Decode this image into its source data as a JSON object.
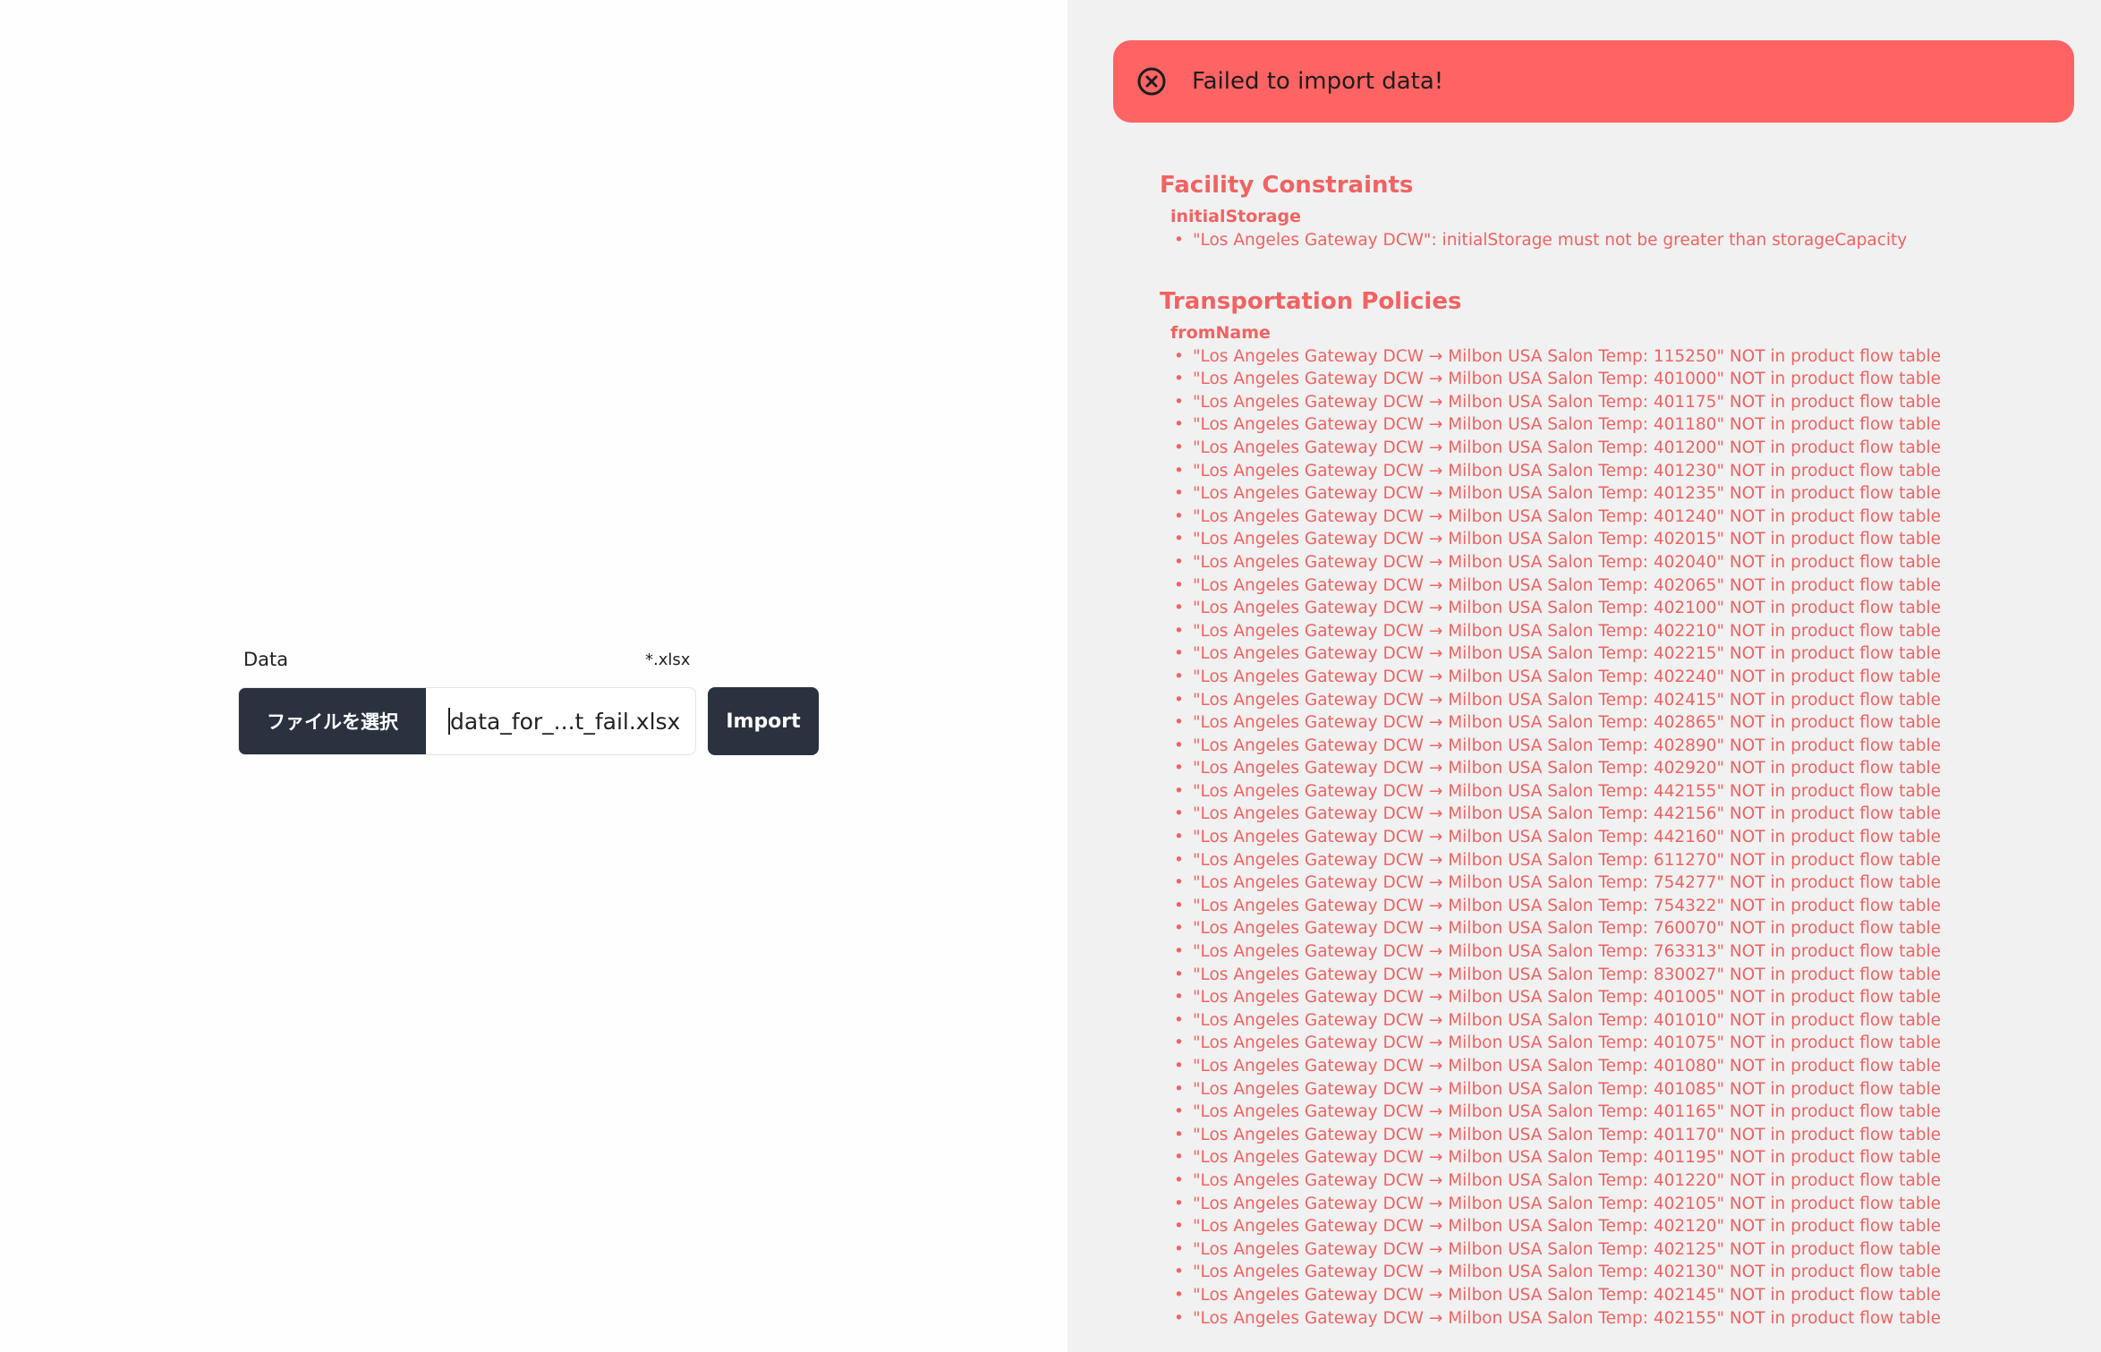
{
  "upload": {
    "label": "Data",
    "accept_hint": "*.xlsx",
    "file_button_label": "ファイルを選択",
    "file_name": "data_for_...t_fail.xlsx",
    "import_label": "Import"
  },
  "alert": {
    "message": "Failed to import data!",
    "icon": "x-circle-icon",
    "color": "#ff6363"
  },
  "errors": [
    {
      "section": "Facility Constraints",
      "field": "initialStorage",
      "messages": [
        "\"Los Angeles Gateway DCW\": initialStorage must not be greater than storageCapacity"
      ]
    },
    {
      "section": "Transportation Policies",
      "field": "fromName",
      "messages": [
        "\"Los Angeles Gateway DCW → Milbon USA Salon Temp: 115250\" NOT in product flow table",
        "\"Los Angeles Gateway DCW → Milbon USA Salon Temp: 401000\" NOT in product flow table",
        "\"Los Angeles Gateway DCW → Milbon USA Salon Temp: 401175\" NOT in product flow table",
        "\"Los Angeles Gateway DCW → Milbon USA Salon Temp: 401180\" NOT in product flow table",
        "\"Los Angeles Gateway DCW → Milbon USA Salon Temp: 401200\" NOT in product flow table",
        "\"Los Angeles Gateway DCW → Milbon USA Salon Temp: 401230\" NOT in product flow table",
        "\"Los Angeles Gateway DCW → Milbon USA Salon Temp: 401235\" NOT in product flow table",
        "\"Los Angeles Gateway DCW → Milbon USA Salon Temp: 401240\" NOT in product flow table",
        "\"Los Angeles Gateway DCW → Milbon USA Salon Temp: 402015\" NOT in product flow table",
        "\"Los Angeles Gateway DCW → Milbon USA Salon Temp: 402040\" NOT in product flow table",
        "\"Los Angeles Gateway DCW → Milbon USA Salon Temp: 402065\" NOT in product flow table",
        "\"Los Angeles Gateway DCW → Milbon USA Salon Temp: 402100\" NOT in product flow table",
        "\"Los Angeles Gateway DCW → Milbon USA Salon Temp: 402210\" NOT in product flow table",
        "\"Los Angeles Gateway DCW → Milbon USA Salon Temp: 402215\" NOT in product flow table",
        "\"Los Angeles Gateway DCW → Milbon USA Salon Temp: 402240\" NOT in product flow table",
        "\"Los Angeles Gateway DCW → Milbon USA Salon Temp: 402415\" NOT in product flow table",
        "\"Los Angeles Gateway DCW → Milbon USA Salon Temp: 402865\" NOT in product flow table",
        "\"Los Angeles Gateway DCW → Milbon USA Salon Temp: 402890\" NOT in product flow table",
        "\"Los Angeles Gateway DCW → Milbon USA Salon Temp: 402920\" NOT in product flow table",
        "\"Los Angeles Gateway DCW → Milbon USA Salon Temp: 442155\" NOT in product flow table",
        "\"Los Angeles Gateway DCW → Milbon USA Salon Temp: 442156\" NOT in product flow table",
        "\"Los Angeles Gateway DCW → Milbon USA Salon Temp: 442160\" NOT in product flow table",
        "\"Los Angeles Gateway DCW → Milbon USA Salon Temp: 611270\" NOT in product flow table",
        "\"Los Angeles Gateway DCW → Milbon USA Salon Temp: 754277\" NOT in product flow table",
        "\"Los Angeles Gateway DCW → Milbon USA Salon Temp: 754322\" NOT in product flow table",
        "\"Los Angeles Gateway DCW → Milbon USA Salon Temp: 760070\" NOT in product flow table",
        "\"Los Angeles Gateway DCW → Milbon USA Salon Temp: 763313\" NOT in product flow table",
        "\"Los Angeles Gateway DCW → Milbon USA Salon Temp: 830027\" NOT in product flow table",
        "\"Los Angeles Gateway DCW → Milbon USA Salon Temp: 401005\" NOT in product flow table",
        "\"Los Angeles Gateway DCW → Milbon USA Salon Temp: 401010\" NOT in product flow table",
        "\"Los Angeles Gateway DCW → Milbon USA Salon Temp: 401075\" NOT in product flow table",
        "\"Los Angeles Gateway DCW → Milbon USA Salon Temp: 401080\" NOT in product flow table",
        "\"Los Angeles Gateway DCW → Milbon USA Salon Temp: 401085\" NOT in product flow table",
        "\"Los Angeles Gateway DCW → Milbon USA Salon Temp: 401165\" NOT in product flow table",
        "\"Los Angeles Gateway DCW → Milbon USA Salon Temp: 401170\" NOT in product flow table",
        "\"Los Angeles Gateway DCW → Milbon USA Salon Temp: 401195\" NOT in product flow table",
        "\"Los Angeles Gateway DCW → Milbon USA Salon Temp: 401220\" NOT in product flow table",
        "\"Los Angeles Gateway DCW → Milbon USA Salon Temp: 402105\" NOT in product flow table",
        "\"Los Angeles Gateway DCW → Milbon USA Salon Temp: 402120\" NOT in product flow table",
        "\"Los Angeles Gateway DCW → Milbon USA Salon Temp: 402125\" NOT in product flow table",
        "\"Los Angeles Gateway DCW → Milbon USA Salon Temp: 402130\" NOT in product flow table",
        "\"Los Angeles Gateway DCW → Milbon USA Salon Temp: 402145\" NOT in product flow table",
        "\"Los Angeles Gateway DCW → Milbon USA Salon Temp: 402155\" NOT in product flow table"
      ]
    }
  ]
}
